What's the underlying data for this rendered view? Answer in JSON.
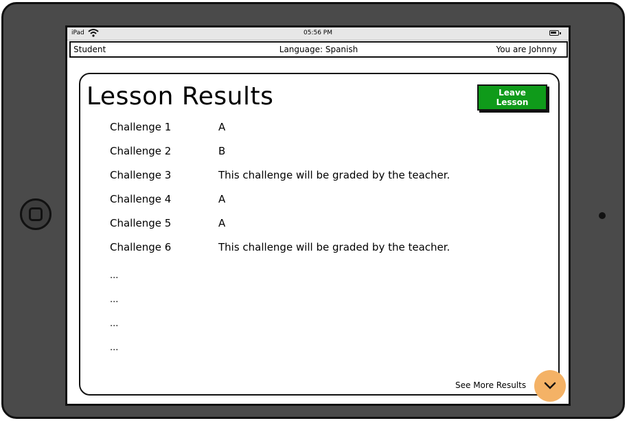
{
  "status_bar": {
    "device": "iPad",
    "time": "05:56 PM"
  },
  "top_bar": {
    "role": "Student",
    "language": "Language: Spanish",
    "user": "You are Johnny"
  },
  "page": {
    "title": "Lesson Results",
    "leave_button": "Leave Lesson"
  },
  "results": [
    {
      "name": "Challenge 1",
      "grade": "A"
    },
    {
      "name": "Challenge 2",
      "grade": "B"
    },
    {
      "name": "Challenge 3",
      "grade": "This challenge will be graded by the teacher."
    },
    {
      "name": "Challenge 4",
      "grade": "A"
    },
    {
      "name": "Challenge 5",
      "grade": "A"
    },
    {
      "name": "Challenge 6",
      "grade": "This challenge will be graded by the teacher."
    }
  ],
  "more_placeholder": [
    "...",
    "...",
    "...",
    "..."
  ],
  "see_more": {
    "label": "See More Results",
    "icon": "chevron-down-icon"
  },
  "colors": {
    "leave_button": "#0f9b1a",
    "see_more_button": "#f4b266"
  }
}
